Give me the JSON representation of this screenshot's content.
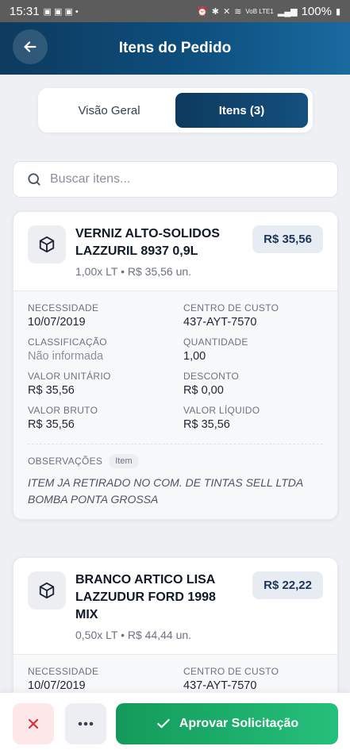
{
  "status_bar": {
    "time": "15:31",
    "battery": "100%",
    "network": "VoB LTE1"
  },
  "header": {
    "title": "Itens do Pedido"
  },
  "tabs": [
    {
      "label": "Visão Geral"
    },
    {
      "label": "Itens (3)"
    }
  ],
  "search": {
    "placeholder": "Buscar itens..."
  },
  "items": [
    {
      "name": "VERNIZ ALTO-SOLIDOS LAZZURIL 8937 0,9L",
      "qty_line": "1,00x LT",
      "unit_line": "R$ 35,56 un.",
      "price": "R$ 35,56",
      "fields": [
        {
          "label": "NECESSIDADE",
          "value": "10/07/2019"
        },
        {
          "label": "CENTRO DE CUSTO",
          "value": "437-AYT-7570"
        },
        {
          "label": "CLASSIFICAÇÃO",
          "value": "Não informada"
        },
        {
          "label": "QUANTIDADE",
          "value": "1,00"
        },
        {
          "label": "VALOR UNITÁRIO",
          "value": "R$ 35,56"
        },
        {
          "label": "DESCONTO",
          "value": "R$ 0,00"
        },
        {
          "label": "VALOR BRUTO",
          "value": "R$ 35,56"
        },
        {
          "label": "VALOR LÍQUIDO",
          "value": "R$ 35,56"
        }
      ],
      "obs_label": "OBSERVAÇÕES",
      "obs_badge": "Item",
      "obs_text": "ITEM JA RETIRADO NO COM. DE TINTAS SELL LTDA BOMBA PONTA GROSSA"
    },
    {
      "name": "BRANCO ARTICO LISA LAZZUDUR FORD 1998 MIX",
      "qty_line": "0,50x LT",
      "unit_line": "R$ 44,44 un.",
      "price": "R$ 22,22",
      "fields": [
        {
          "label": "NECESSIDADE",
          "value": "10/07/2019"
        },
        {
          "label": "CENTRO DE CUSTO",
          "value": "437-AYT-7570"
        }
      ]
    }
  ],
  "footer": {
    "approve_label": "Aprovar Solicitação"
  },
  "colors": {
    "header_dark": "#0d3a5e",
    "approve_green": "#1fae6b",
    "reject_bg": "#fde7e9",
    "reject_icon": "#d9303e"
  },
  "icons": {
    "back": "arrow-left-icon",
    "search": "search-icon",
    "item": "package-icon",
    "reject": "close-icon",
    "more": "more-icon",
    "approve": "check-icon"
  }
}
